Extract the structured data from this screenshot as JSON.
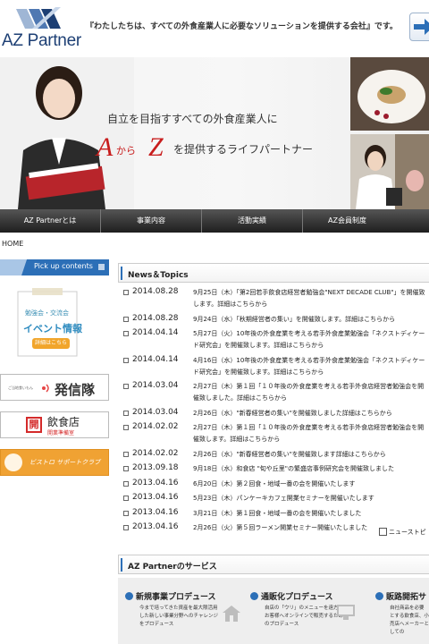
{
  "header": {
    "logo_text": "AZ Partner",
    "tagline": "『わたしたちは、すべての外食産業人に必要なソリューションを提供する会社』です。"
  },
  "hero": {
    "line1": "自立を目指すすべての外食産業人に",
    "line2_a": "A",
    "line2_kara": "から",
    "line2_z": "Z",
    "line2_rest": "を提供するライフパートナー"
  },
  "nav": [
    "AZ Partnerとは",
    "事業内容",
    "活動実績",
    "AZ会員制度"
  ],
  "breadcrumb": "HOME",
  "sidebar": {
    "pickup_label": "Pick up contents",
    "event_line1": "勉強会・交流会",
    "event_line2": "イベント情報",
    "event_button": "詳細はこちら",
    "hatsu_small": "ご当地食いもん",
    "hatsu_big": "発信隊",
    "inshoku_icon": "開",
    "inshoku_big": "飲食店",
    "inshoku_small": "開業準備室",
    "bistro_text": "ビストロ サポートクラブ"
  },
  "news": {
    "title": "News＆Topics",
    "items": [
      {
        "date": "2014.08.28",
        "text": "9月25日（木）「第2回若手飲食店経営者勉強会\"NEXT DECADE CLUB\"」を開催致します。詳細はこちらから"
      },
      {
        "date": "2014.08.28",
        "text": "9月24日（水）「秋期経営者の集い」を開催致します。詳細はこちらから"
      },
      {
        "date": "2014.04.14",
        "text": "5月27日（火）10年後の外食産業を考える若手外食産業勉強会「ネクストディケード研究会」を開催致します。詳細はこちらから"
      },
      {
        "date": "2014.04.14",
        "text": "4月16日（水）10年後の外食産業を考える若手外食産業勉強会「ネクストディケード研究会」を開催致します。詳細はこちらから"
      },
      {
        "date": "2014.03.04",
        "text": "2月27日（木）第１回「１０年後の外食産業を考える若手外食店経営者勉強会を開催致しました。詳細はこちらから"
      },
      {
        "date": "2014.03.04",
        "text": "2月26日（水）\"新春経営者の集い\"を開催致しました詳細はこちらから"
      },
      {
        "date": "2014.02.02",
        "text": "2月27日（木）第１回「１０年後の外食産業を考える若手外食店経営者勉強会を開催致します。詳細はこちらから"
      },
      {
        "date": "2014.02.02",
        "text": "2月26日（水）\"新春経営者の集い\"を開催致します詳細はこちらから"
      },
      {
        "date": "2013.09.18",
        "text": "9月18日（水）和食店 \"旬や丘里\"の繁盛店事例研究会を開催致しました"
      },
      {
        "date": "2013.04.16",
        "text": "6月20日（木）第２回食・地域一番の会を開催いたします"
      },
      {
        "date": "2013.04.16",
        "text": "5月23日（木）パンケーキカフェ開業セミナーを開催いたします"
      },
      {
        "date": "2013.04.16",
        "text": "3月21日（木）第１回食・地域一番の会を開催いたしました"
      },
      {
        "date": "2013.04.16",
        "text": "2月26日（火）第５回ラーメン開業セミナー開催いたしました"
      }
    ],
    "more_label": "ニューストピ"
  },
  "services": {
    "title": "AZ Partnerのサービス",
    "cards": [
      {
        "title": "新規事業プロデュース",
        "desc": "今まで培ってきた資産を最大限活用した新しい事業分野へのチャレンジをプロデュース"
      },
      {
        "title": "通販化プロデュース",
        "desc": "自店の「ウリ」のメニューを遠方のお客様へオンラインで販売するためのプロデュース"
      },
      {
        "title": "販路開拓サ",
        "desc": "自社商品を必要とする飲食店、小売店へメーカーとしての"
      }
    ]
  },
  "colors": {
    "brand_navy": "#1d3f74",
    "accent_blue": "#2c6fb7",
    "nav_dark": "#2a2a2a",
    "hero_red": "#c81d1d",
    "button_orange": "#f1a52b"
  }
}
